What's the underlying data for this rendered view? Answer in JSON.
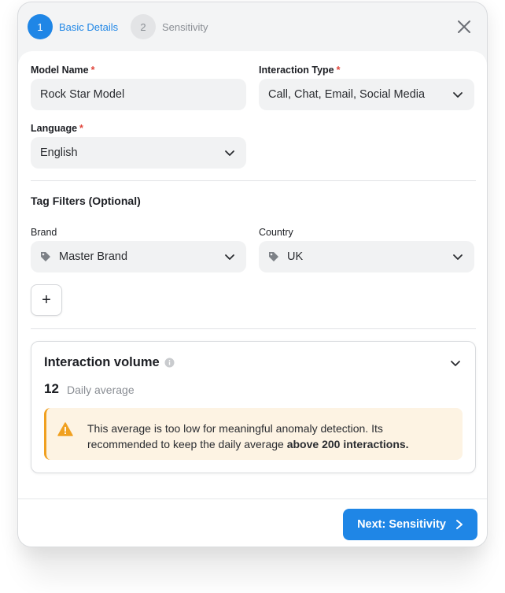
{
  "stepper": {
    "steps": [
      {
        "number": "1",
        "label": "Basic Details"
      },
      {
        "number": "2",
        "label": "Sensitivity"
      }
    ]
  },
  "form": {
    "model_name": {
      "label": "Model Name",
      "required_mark": "*",
      "value": "Rock Star Model"
    },
    "interaction_type": {
      "label": "Interaction Type",
      "required_mark": "*",
      "value": "Call, Chat, Email, Social Media"
    },
    "language": {
      "label": "Language",
      "required_mark": "*",
      "value": "English"
    }
  },
  "tag_filters": {
    "title": "Tag Filters (Optional)",
    "brand": {
      "label": "Brand",
      "value": "Master Brand"
    },
    "country": {
      "label": "Country",
      "value": "UK"
    },
    "add_button": "+"
  },
  "volume": {
    "title": "Interaction volume",
    "value": "12",
    "caption": "Daily average",
    "warning_text": "This average is too low for meaningful anomaly detection. Its recommended to keep the daily average ",
    "warning_emphasis": "above 200 interactions."
  },
  "footer": {
    "next_label": "Next: Sensitivity"
  },
  "colors": {
    "accent": "#1f86e6",
    "warning_bg": "#fdf3e3",
    "warning_icon": "#f0a020",
    "required": "#e0443a"
  },
  "icons": [
    "close-icon",
    "chevron-down-icon",
    "tag-icon",
    "info-icon",
    "warning-icon",
    "chevron-right-icon"
  ]
}
